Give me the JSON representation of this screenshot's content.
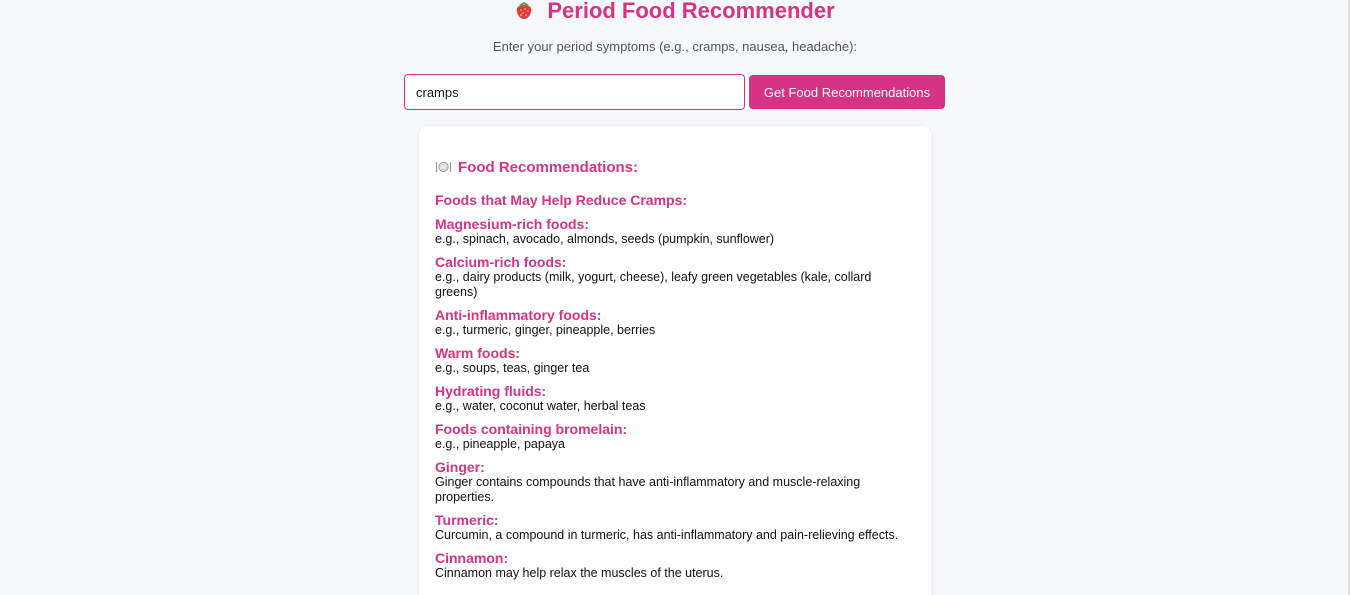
{
  "header": {
    "title": "Period Food Recommender",
    "title_icon": "strawberry-icon",
    "subtitle": "Enter your period symptoms (e.g., cramps, nausea, headache):"
  },
  "form": {
    "input_value": "cramps",
    "button_label": "Get Food Recommendations"
  },
  "results": {
    "heading_icon": "plate-icon",
    "heading": "Food Recommendations:",
    "section_title": "Foods that May Help Reduce Cramps:",
    "items": [
      {
        "name": "Magnesium-rich foods:",
        "detail": "e.g., spinach, avocado, almonds, seeds (pumpkin, sunflower)"
      },
      {
        "name": "Calcium-rich foods:",
        "detail": "e.g., dairy products (milk, yogurt, cheese), leafy green vegetables (kale, collard greens)"
      },
      {
        "name": "Anti-inflammatory foods:",
        "detail": "e.g., turmeric, ginger, pineapple, berries"
      },
      {
        "name": "Warm foods:",
        "detail": "e.g., soups, teas, ginger tea"
      },
      {
        "name": "Hydrating fluids:",
        "detail": "e.g., water, coconut water, herbal teas"
      },
      {
        "name": "Foods containing bromelain:",
        "detail": "e.g., pineapple, papaya"
      },
      {
        "name": "Ginger:",
        "detail": "Ginger contains compounds that have anti-inflammatory and muscle-relaxing properties."
      },
      {
        "name": "Turmeric:",
        "detail": "Curcumin, a compound in turmeric, has anti-inflammatory and pain-relieving effects."
      },
      {
        "name": "Cinnamon:",
        "detail": "Cinnamon may help relax the muscles of the uterus."
      }
    ]
  },
  "colors": {
    "accent": "#d63384",
    "background": "#f7f8fa"
  }
}
